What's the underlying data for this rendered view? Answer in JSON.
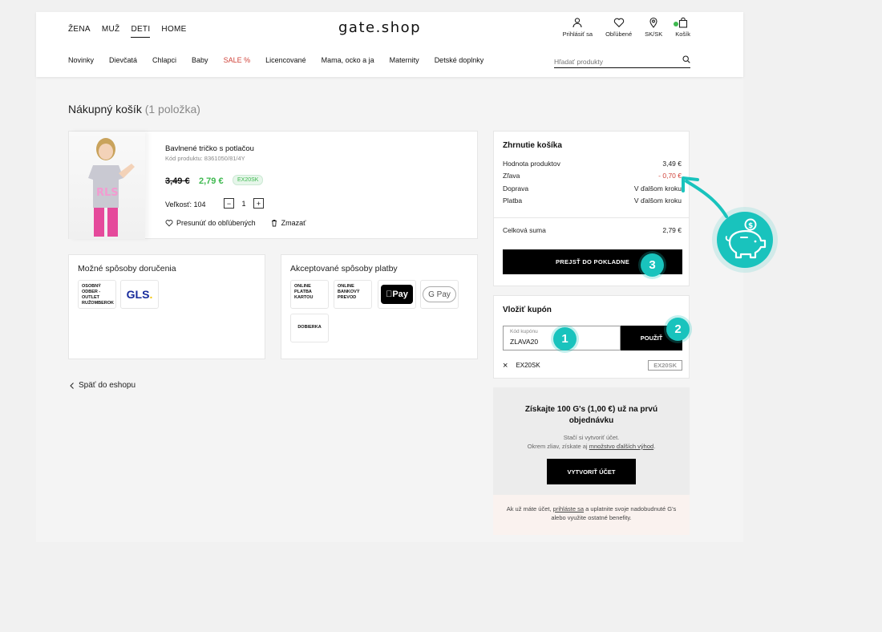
{
  "header": {
    "top_nav": [
      "ŽENA",
      "MUŽ",
      "DETI",
      "HOME"
    ],
    "active_top_nav": "DETI",
    "logo": "gate.shop",
    "icons": [
      {
        "name": "user-icon",
        "label": "Prihlásiť sa"
      },
      {
        "name": "heart-icon",
        "label": "Obľúbené"
      },
      {
        "name": "location-icon",
        "label": "SK/SK"
      },
      {
        "name": "cart-icon",
        "label": "Košík"
      }
    ],
    "categories": [
      "Novinky",
      "Dievčatá",
      "Chlapci",
      "Baby",
      "SALE %",
      "Licencované",
      "Mama, ocko a ja",
      "Maternity",
      "Detské doplnky"
    ],
    "search_placeholder": "Hľadať produkty"
  },
  "page_title": "Nákupný košík",
  "page_title_count": "(1 položka)",
  "product": {
    "name": "Bavlnené tričko s potlačou",
    "code": "Kód produktu: 8361050/81/4Y",
    "old_price": "3,49 €",
    "new_price": "2,79 €",
    "badge": "EX20SK",
    "size": "Veľkosť: 104",
    "quantity": "1",
    "minus": "−",
    "plus": "+",
    "move_to_favorites": "Presunúť do obľúbených",
    "delete": "Zmazať"
  },
  "delivery": {
    "title": "Možné spôsoby doručenia",
    "options": [
      "OSOBNÝ ODBER - OUTLET RUŽOMBEROK",
      "GLS"
    ]
  },
  "payment": {
    "title": "Akceptované spôsoby platby",
    "options": [
      "ONLINE PLATBA KARTOU",
      "ONLINE BANKOVÝ PREVOD",
      "Pay",
      "G Pay",
      "DOBIERKA"
    ]
  },
  "back_link": "Späť do eshopu",
  "summary": {
    "title": "Zhrnutie košíka",
    "rows": [
      {
        "label": "Hodnota produktov",
        "value": "3,49 €"
      },
      {
        "label": "Zľava",
        "value": "- 0,70 €"
      },
      {
        "label": "Doprava",
        "value": "V ďalšom kroku"
      },
      {
        "label": "Platba",
        "value": "V ďalšom kroku"
      }
    ],
    "total_label": "Celková suma",
    "total_value": "2,79 €",
    "checkout_button": "PREJSŤ DO POKLADNE"
  },
  "coupon": {
    "title": "Vložiť kupón",
    "input_label": "Kód kupónu",
    "input_value": "ZLAVA20",
    "apply_button": "POUŽIŤ",
    "remove": "×",
    "applied_code": "EX20SK",
    "applied_badge": "EX20SK"
  },
  "promo": {
    "heading": "Získajte 100 G's (1,00 €) už na prvú objednávku",
    "sub1": "Stačí si vytvoriť účet.",
    "sub2": "Okrem zliav, získate aj",
    "sub_link": "množstvo ďalších výhod",
    "sub_end": ".",
    "create_button": "VYTVORIŤ ÚČET",
    "footer1": "Ak už máte účet,",
    "footer_link": "prihláste sa",
    "footer2": "a uplatnite svoje nadobudnuté G's alebo využite ostatné benefity."
  },
  "steps": [
    "1",
    "2",
    "3"
  ],
  "accent_color": "#19c3bd"
}
